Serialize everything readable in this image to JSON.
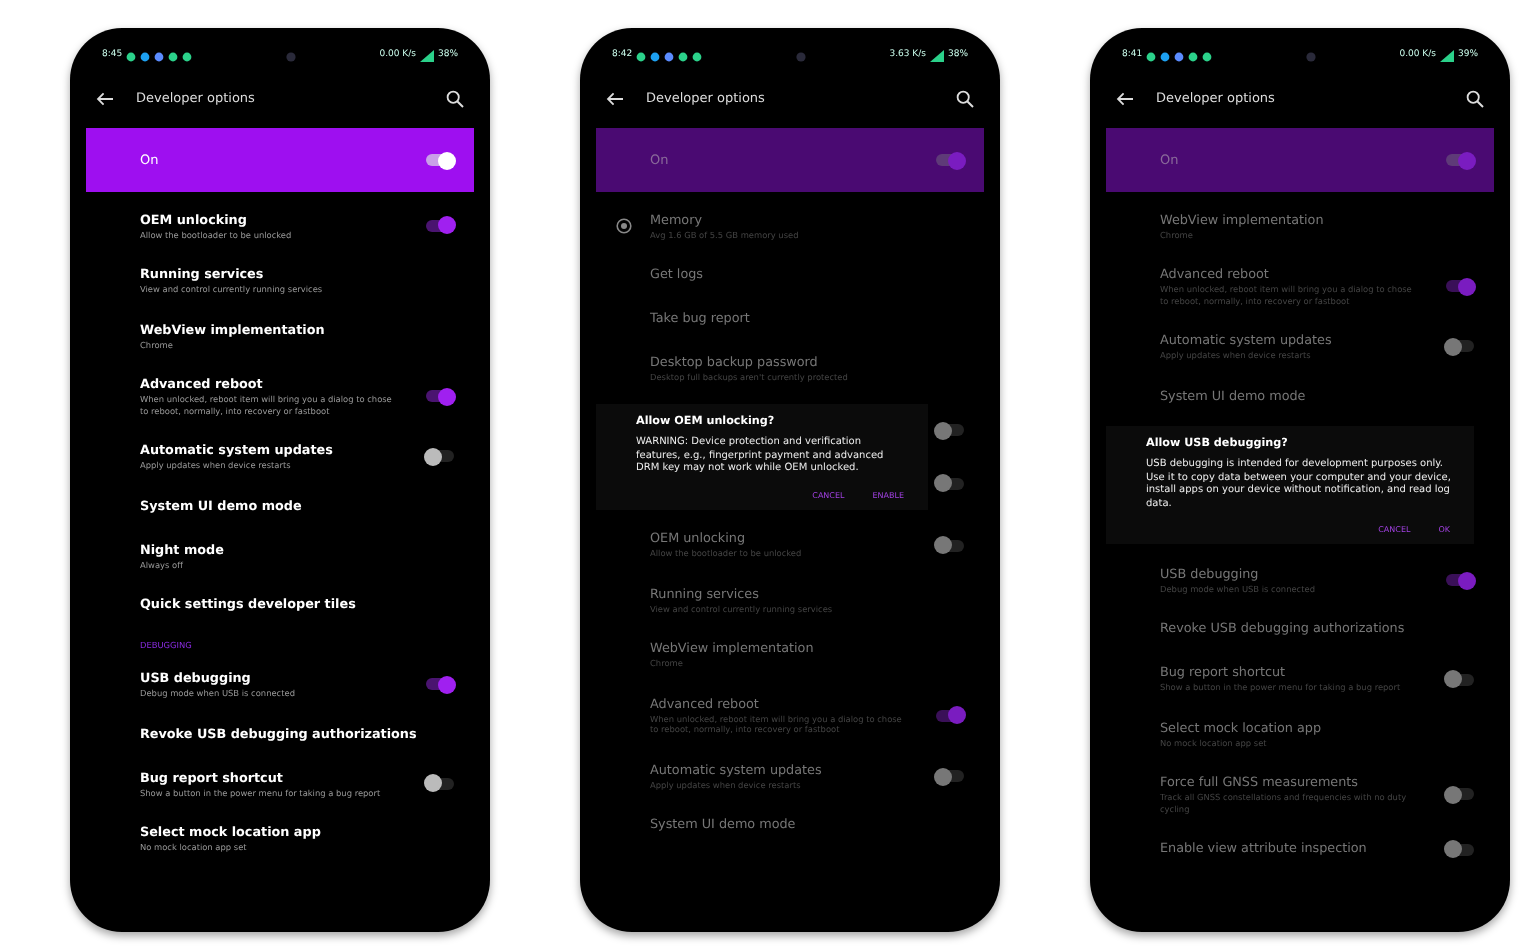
{
  "phones": [
    {
      "status": {
        "time": "8:45",
        "speed": "0.00 K/s",
        "battery": "38%"
      },
      "title": "Developer options",
      "dimmed": false,
      "master": {
        "label": "On",
        "on": true
      },
      "items": [
        {
          "kind": "toggle",
          "title": "OEM unlocking",
          "subtitle": "Allow the bootloader to be unlocked",
          "on": true
        },
        {
          "kind": "plain",
          "title": "Running services",
          "subtitle": "View and control currently running services"
        },
        {
          "kind": "plain",
          "title": "WebView implementation",
          "subtitle": "Chrome"
        },
        {
          "kind": "toggle",
          "title": "Advanced reboot",
          "subtitle": "When unlocked, reboot item will bring you a dialog to chose to reboot, normally, into recovery or fastboot",
          "on": true
        },
        {
          "kind": "toggle",
          "title": "Automatic system updates",
          "subtitle": "Apply updates when device restarts",
          "on": false
        },
        {
          "kind": "plain",
          "title": "System UI demo mode"
        },
        {
          "kind": "plain",
          "title": "Night mode",
          "subtitle": "Always off"
        },
        {
          "kind": "plain",
          "title": "Quick settings developer tiles"
        },
        {
          "kind": "header",
          "title": "DEBUGGING"
        },
        {
          "kind": "toggle",
          "title": "USB debugging",
          "subtitle": "Debug mode when USB is connected",
          "on": true
        },
        {
          "kind": "plain",
          "title": "Revoke USB debugging authorizations"
        },
        {
          "kind": "toggle",
          "title": "Bug report shortcut",
          "subtitle": "Show a button in the power menu for taking a bug report",
          "on": false
        },
        {
          "kind": "plain",
          "title": "Select mock location app",
          "subtitle": "No mock location app set"
        }
      ]
    },
    {
      "status": {
        "time": "8:42",
        "speed": "3.63 K/s",
        "battery": "38%"
      },
      "title": "Developer options",
      "dimmed": true,
      "master": {
        "label": "On",
        "on": true
      },
      "items": [
        {
          "kind": "icon",
          "title": "Memory",
          "subtitle": "Avg 1.6 GB of 5.5 GB memory used"
        },
        {
          "kind": "plain",
          "title": "Get logs"
        },
        {
          "kind": "plain",
          "title": "Take bug report"
        },
        {
          "kind": "plain",
          "title": "Desktop backup password",
          "subtitle": "Desktop full backups aren't currently protected"
        },
        {
          "kind": "dialog",
          "title": "Allow OEM unlocking?",
          "message": "WARNING: Device protection and verification features, e.g., fingerprint payment and advanced DRM key may not work while OEM unlocked.",
          "buttons": [
            "CANCEL",
            "ENABLE"
          ],
          "side_toggles": [
            {
              "on": false
            },
            {
              "on": false
            }
          ]
        },
        {
          "kind": "toggle",
          "title": "OEM unlocking",
          "subtitle": "Allow the bootloader to be unlocked",
          "on": false
        },
        {
          "kind": "plain",
          "title": "Running services",
          "subtitle": "View and control currently running services"
        },
        {
          "kind": "plain",
          "title": "WebView implementation",
          "subtitle": "Chrome"
        },
        {
          "kind": "toggle",
          "title": "Advanced reboot",
          "subtitle": "When unlocked, reboot item will bring you a dialog to chose to reboot, normally, into recovery or fastboot",
          "on": true
        },
        {
          "kind": "toggle",
          "title": "Automatic system updates",
          "subtitle": "Apply updates when device restarts",
          "on": false
        },
        {
          "kind": "plain",
          "title": "System UI demo mode"
        }
      ]
    },
    {
      "status": {
        "time": "8:41",
        "speed": "0.00 K/s",
        "battery": "39%"
      },
      "title": "Developer options",
      "dimmed": true,
      "master": {
        "label": "On",
        "on": true
      },
      "items": [
        {
          "kind": "plain",
          "title": "WebView implementation",
          "subtitle": "Chrome"
        },
        {
          "kind": "toggle",
          "title": "Advanced reboot",
          "subtitle": "When unlocked, reboot item will bring you a dialog to chose to reboot, normally, into recovery or fastboot",
          "on": true
        },
        {
          "kind": "toggle",
          "title": "Automatic system updates",
          "subtitle": "Apply updates when device restarts",
          "on": false
        },
        {
          "kind": "plain",
          "title": "System UI demo mode"
        },
        {
          "kind": "dialog",
          "title": "Allow USB debugging?",
          "message": "USB debugging is intended for development purposes only. Use it to copy data between your computer and your device, install apps on your device without notification, and read log data.",
          "buttons": [
            "CANCEL",
            "OK"
          ]
        },
        {
          "kind": "toggle",
          "title": "USB debugging",
          "subtitle": "Debug mode when USB is connected",
          "on": true
        },
        {
          "kind": "plain",
          "title": "Revoke USB debugging authorizations"
        },
        {
          "kind": "toggle",
          "title": "Bug report shortcut",
          "subtitle": "Show a button in the power menu for taking a bug report",
          "on": false
        },
        {
          "kind": "plain",
          "title": "Select mock location app",
          "subtitle": "No mock location app set"
        },
        {
          "kind": "toggle",
          "title": "Force full GNSS measurements",
          "subtitle": "Track all GNSS constellations and frequencies with no duty cycling",
          "on": false
        },
        {
          "kind": "toggle",
          "title": "Enable view attribute inspection",
          "on": false
        }
      ]
    }
  ]
}
